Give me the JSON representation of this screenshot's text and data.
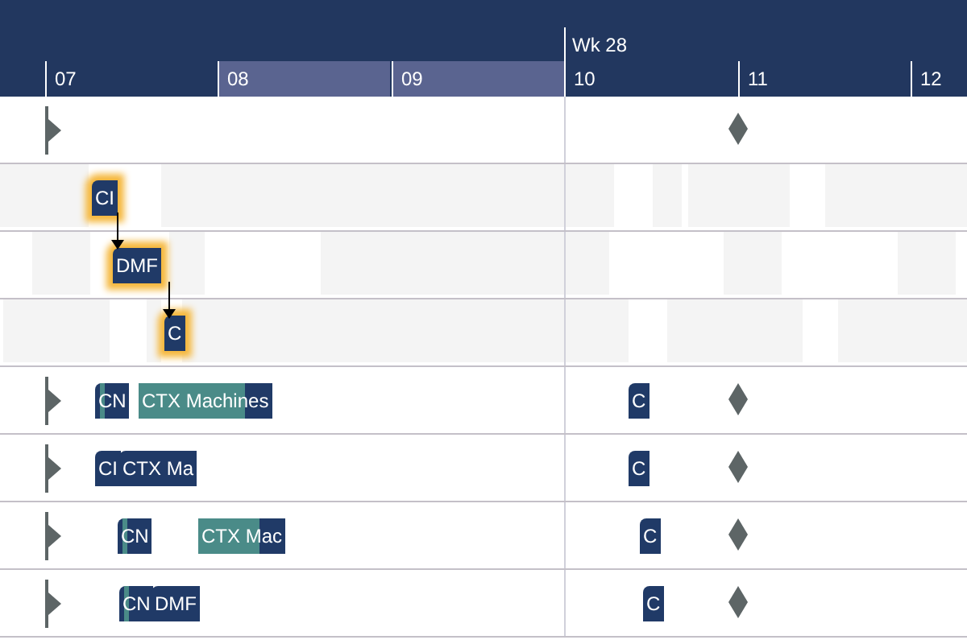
{
  "timeline": {
    "week_label": "Wk 28",
    "days": [
      {
        "label": "07",
        "selected": false
      },
      {
        "label": "08",
        "selected": true
      },
      {
        "label": "09",
        "selected": true
      },
      {
        "label": "10",
        "selected": false
      },
      {
        "label": "11",
        "selected": false
      },
      {
        "label": "12",
        "selected": false
      }
    ]
  },
  "rows": [
    {
      "kind": "task",
      "bars": []
    },
    {
      "kind": "resource",
      "bars": [
        {
          "label": "CI",
          "selected": true
        }
      ]
    },
    {
      "kind": "resource",
      "bars": [
        {
          "label": "DMF",
          "selected": true
        }
      ]
    },
    {
      "kind": "resource",
      "bars": [
        {
          "label": "C",
          "selected": true
        }
      ]
    },
    {
      "kind": "task",
      "bars": [
        {
          "label": "CN",
          "selected": false,
          "split_marker": true
        },
        {
          "label": "CTX Machines",
          "selected": false,
          "level": 0.8
        },
        {
          "label": "C",
          "selected": false
        }
      ]
    },
    {
      "kind": "task",
      "bars": [
        {
          "label": "CI",
          "selected": false
        },
        {
          "label": "CTX Ma",
          "selected": false
        },
        {
          "label": "C",
          "selected": false
        }
      ]
    },
    {
      "kind": "task",
      "bars": [
        {
          "label": "CN",
          "selected": false,
          "split_marker": true
        },
        {
          "label": "CTX Mac",
          "selected": false,
          "level": 0.7
        },
        {
          "label": "C",
          "selected": false
        }
      ]
    },
    {
      "kind": "task",
      "bars": [
        {
          "label": "CN",
          "selected": false,
          "split_marker": true
        },
        {
          "label": "DMF",
          "selected": false
        },
        {
          "label": "C",
          "selected": false
        }
      ]
    }
  ]
}
